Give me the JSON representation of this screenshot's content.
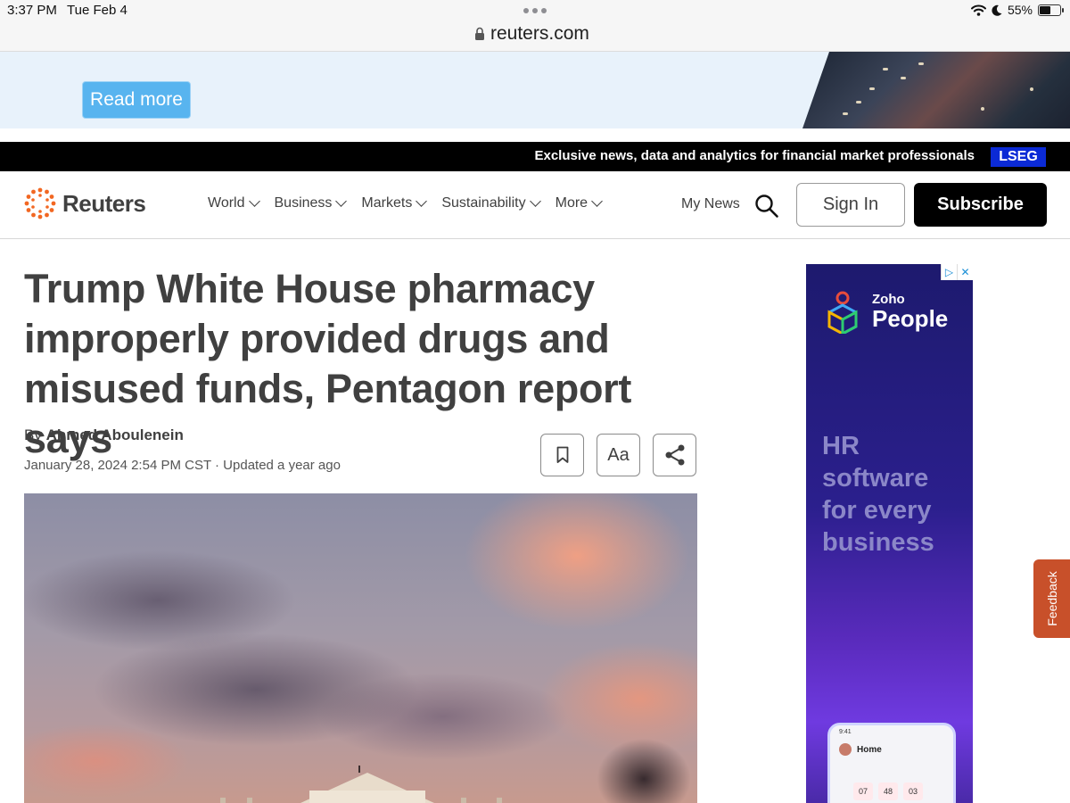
{
  "status_bar": {
    "time": "3:37 PM",
    "date": "Tue Feb 4",
    "battery": "55%",
    "battery_level": 0.55,
    "url": "reuters.com"
  },
  "top_ad": {
    "button_label": "Read more"
  },
  "promo_bar": {
    "text": "Exclusive news, data and analytics for financial market professionals",
    "badge": "LSEG"
  },
  "header": {
    "logo_text": "Reuters",
    "nav": [
      {
        "label": "World"
      },
      {
        "label": "Business"
      },
      {
        "label": "Markets"
      },
      {
        "label": "Sustainability"
      },
      {
        "label": "More"
      }
    ],
    "my_news": "My News",
    "sign_in": "Sign In",
    "subscribe": "Subscribe"
  },
  "article": {
    "headline": "Trump White House pharmacy improperly provided drugs and misused funds, Pentagon report says",
    "by_prefix": "By",
    "author": "Ahmed Aboulenein",
    "dateline": "January 28, 2024 2:54 PM CST · Updated a year ago",
    "font_button": "Aa"
  },
  "side_ad": {
    "brand_small": "Zoho",
    "brand_big": "People",
    "copy": "HR software for every business",
    "phone_title": "Home",
    "phone_time": "9:41",
    "phone_numbers": [
      "07",
      "48",
      "03"
    ]
  },
  "feedback": "Feedback",
  "colors": {
    "text": "#404040",
    "promo_badge": "#0b2ad6",
    "read_more": "#58b4ef",
    "feedback": "#c8502a"
  }
}
